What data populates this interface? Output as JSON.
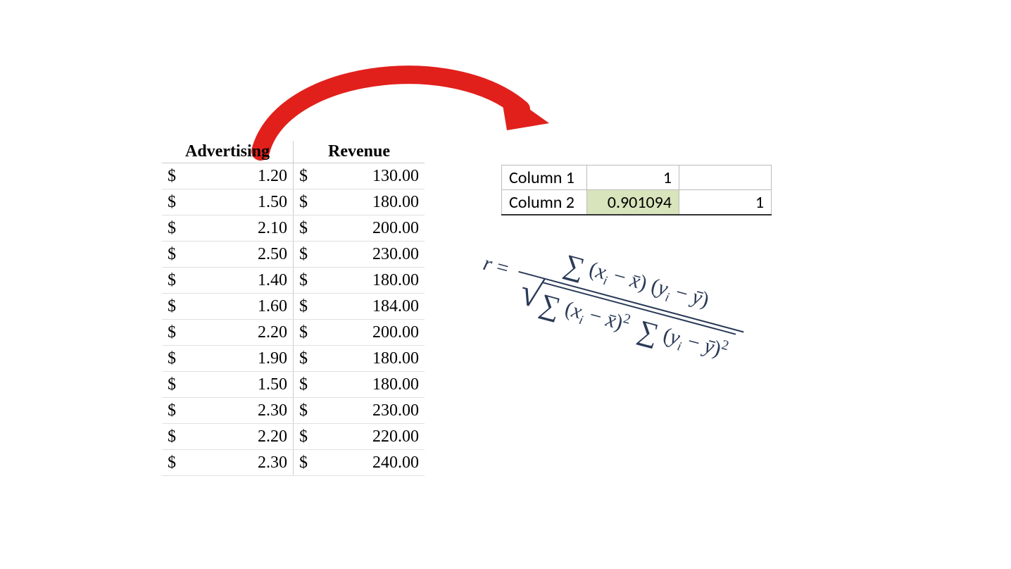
{
  "data_table": {
    "headers": {
      "col1": "Advertising",
      "col2": "Revenue"
    },
    "currency": "$",
    "rows": [
      {
        "adv": "1.20",
        "rev": "130.00"
      },
      {
        "adv": "1.50",
        "rev": "180.00"
      },
      {
        "adv": "2.10",
        "rev": "200.00"
      },
      {
        "adv": "2.50",
        "rev": "230.00"
      },
      {
        "adv": "1.40",
        "rev": "180.00"
      },
      {
        "adv": "1.60",
        "rev": "184.00"
      },
      {
        "adv": "2.20",
        "rev": "200.00"
      },
      {
        "adv": "1.90",
        "rev": "180.00"
      },
      {
        "adv": "1.50",
        "rev": "180.00"
      },
      {
        "adv": "2.30",
        "rev": "230.00"
      },
      {
        "adv": "2.20",
        "rev": "220.00"
      },
      {
        "adv": "2.30",
        "rev": "240.00"
      }
    ]
  },
  "corr_table": {
    "row1": {
      "label": "Column 1",
      "v1": "1",
      "v2": ""
    },
    "row2": {
      "label": "Column 2",
      "v1": "0.901094",
      "v2": "1"
    }
  },
  "formula": {
    "lhs": "r =",
    "numerator": "∑ (xᵢ − x̄)(yᵢ − ȳ)",
    "denominator": "√ ∑ (xᵢ − x̄)² ∑ (yᵢ − ȳ)²",
    "plain": "r = Σ(xi − x̄)(yi − ȳ) / √[ Σ(xi − x̄)² · Σ(yi − ȳ)² ]"
  },
  "arrow": {
    "color": "#e1201c"
  },
  "correlation_value": 0.901094
}
